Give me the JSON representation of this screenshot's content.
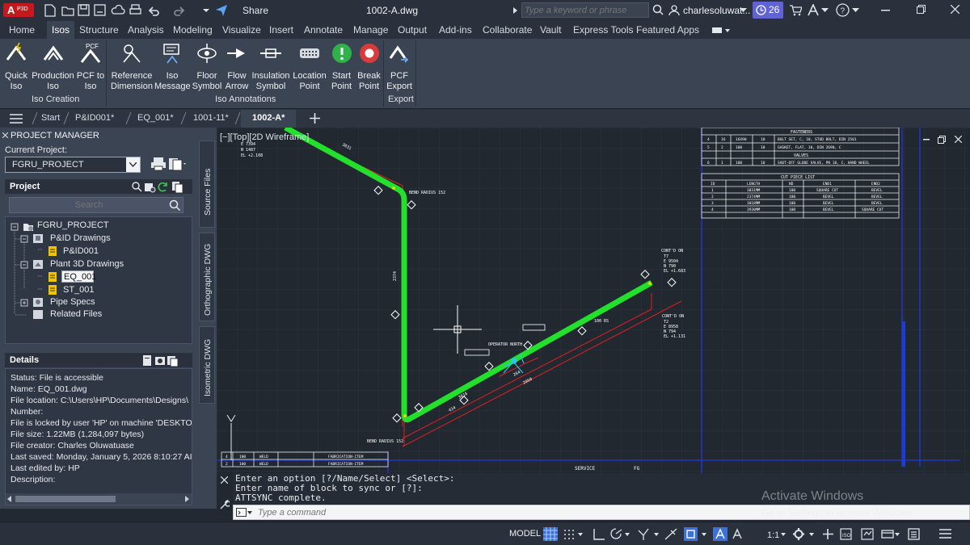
{
  "app": {
    "logo_letter": "A",
    "badge": "P3D",
    "file_title": "1002-A.dwg",
    "share_label": "Share"
  },
  "search": {
    "placeholder": "Type a keyword or phrase"
  },
  "user": {
    "name": "charlesoluwat...",
    "trial_days": "26"
  },
  "ribbon_tabs": [
    "Home",
    "Isos",
    "Structure",
    "Analysis",
    "Modeling",
    "Visualize",
    "Insert",
    "Annotate",
    "Manage",
    "Output",
    "Add-ins",
    "Collaborate",
    "Vault",
    "Express Tools",
    "Featured Apps"
  ],
  "ribbon_buttons": [
    {
      "line1": "Quick",
      "line2": "Iso",
      "icon": "quick-iso-icon"
    },
    {
      "line1": "Production",
      "line2": "Iso",
      "icon": "production-iso-icon"
    },
    {
      "line1": "PCF to",
      "line2": "Iso",
      "icon": "pcf-to-iso-icon"
    },
    {
      "line1": "Reference",
      "line2": "Dimension",
      "icon": "reference-dimension-icon"
    },
    {
      "line1": "Iso",
      "line2": "Message",
      "icon": "iso-message-icon"
    },
    {
      "line1": "Floor",
      "line2": "Symbol",
      "icon": "floor-symbol-icon"
    },
    {
      "line1": "Flow",
      "line2": "Arrow",
      "icon": "flow-arrow-icon"
    },
    {
      "line1": "Insulation",
      "line2": "Symbol",
      "icon": "insulation-symbol-icon"
    },
    {
      "line1": "Location",
      "line2": "Point",
      "icon": "location-point-icon"
    },
    {
      "line1": "Start",
      "line2": "Point",
      "icon": "start-point-icon"
    },
    {
      "line1": "Break",
      "line2": "Point",
      "icon": "break-point-icon"
    },
    {
      "line1": "PCF",
      "line2": "Export",
      "icon": "pcf-export-icon"
    }
  ],
  "ribbon_groups": [
    "Iso Creation",
    "Iso Annotations",
    "Export"
  ],
  "doc_tabs": [
    "Start",
    "P&ID001*",
    "EQ_001*",
    "1001-11*",
    "1002-A*"
  ],
  "project_manager": {
    "title": "PROJECT MANAGER",
    "current_project_label": "Current Project:",
    "current_project": "FGRU_PROJECT",
    "project_header": "Project",
    "search_placeholder": "Search",
    "tree": [
      "FGRU_PROJECT",
      "P&ID Drawings",
      "P&ID001",
      "Plant 3D Drawings",
      "EQ_001",
      "ST_001",
      "Pipe Specs",
      "Related Files"
    ],
    "details_header": "Details",
    "details": [
      "Status: File is accessible",
      "Name: EQ_001.dwg",
      "File location: C:\\Users\\HP\\Documents\\Designs\\",
      "Number:",
      "File is locked by user 'HP' on machine 'DESKTO",
      "File size: 1.22MB (1,284,097 bytes)",
      "File creator: Charles Oluwatuase",
      "Last saved: Monday, January 5, 2026 8:10:27 AI",
      "Last edited by: HP",
      "Description:"
    ]
  },
  "side_tabs": [
    "Source Files",
    "Orthographic DWG",
    "Isometric DWG"
  ],
  "viewport": {
    "label": "[−][Top][2D Wireframe]",
    "fasteners_title": "FASTENERS",
    "fasteners_rows": [
      {
        "c1": "4",
        "c2": "16",
        "c3": "16X90",
        "c4": "10",
        "desc": "BOLT SET, C, 10, STUD BOLT, DIN 2501"
      },
      {
        "c1": "5",
        "c2": "2",
        "c3": "100",
        "c4": "10",
        "desc": "GASKET, FLAT, 10, DIN 2690, C"
      }
    ],
    "valves_title": "VALVES",
    "valves_rows": [
      {
        "c1": "6",
        "c2": "1",
        "c3": "100",
        "c4": "10",
        "desc": "SHUT-OFF GLOBE VALVE, PN 10, C, HAND WHEEL"
      }
    ],
    "cut_title": "CUT PIECE LIST",
    "cut_headers": [
      "ID",
      "LENGTH",
      "ND",
      "END1",
      "END2"
    ],
    "cut_rows": [
      [
        "1",
        "3031MM",
        "100",
        "SQUARE CUT",
        "BEVEL"
      ],
      [
        "2",
        "2374MM",
        "100",
        "BEVEL",
        "BEVEL"
      ],
      [
        "3",
        "3018MM",
        "100",
        "BEVEL",
        "BEVEL"
      ],
      [
        "4",
        "3930MM",
        "100",
        "BEVEL",
        "SQUARE CUT"
      ]
    ],
    "annotations": {
      "bend_top": "BEND RADIUS 152",
      "bend_bottom": "BEND RADIUS 152",
      "operator": "OPERATOR NORTH",
      "conn1_title": "CONT'D ON",
      "conn1_lines": [
        "T7",
        "E 9504",
        "N 790",
        "EL +1.683"
      ],
      "conn2_title": "CONT'D ON",
      "conn2_lines": [
        "T2",
        "E 8958",
        "N 794",
        "EL +1.131"
      ],
      "top_coords": [
        "E 7394",
        "N 1487",
        "EL +2.108"
      ],
      "pipe_label": "100 RS",
      "service_label": "SERVICE",
      "fg_label": "FG",
      "bottom_rows": [
        [
          "4",
          "100",
          "WELD",
          "FABRICATION-ITEM"
        ],
        [
          "2",
          "100",
          "WELD",
          "FABRICATION-ITEM"
        ]
      ],
      "dim_labels": [
        "3031",
        "2374",
        "3018",
        "434",
        "284",
        "2060"
      ]
    }
  },
  "command": {
    "history": [
      "Enter an option [?/Name/Select] <Select>:",
      "Enter name of block to sync or [?]:",
      "ATTSYNC complete."
    ],
    "placeholder": "Type a command"
  },
  "watermark": {
    "title": "Activate Windows",
    "subtitle": "Go to Settings to activate Windows."
  },
  "statusbar": {
    "model": "MODEL",
    "scale": "1:1"
  },
  "colors": {
    "pipe": "#22e02c",
    "dimension": "#e02020",
    "frame": "#1f3bd6",
    "accent": "#3c71d8"
  }
}
